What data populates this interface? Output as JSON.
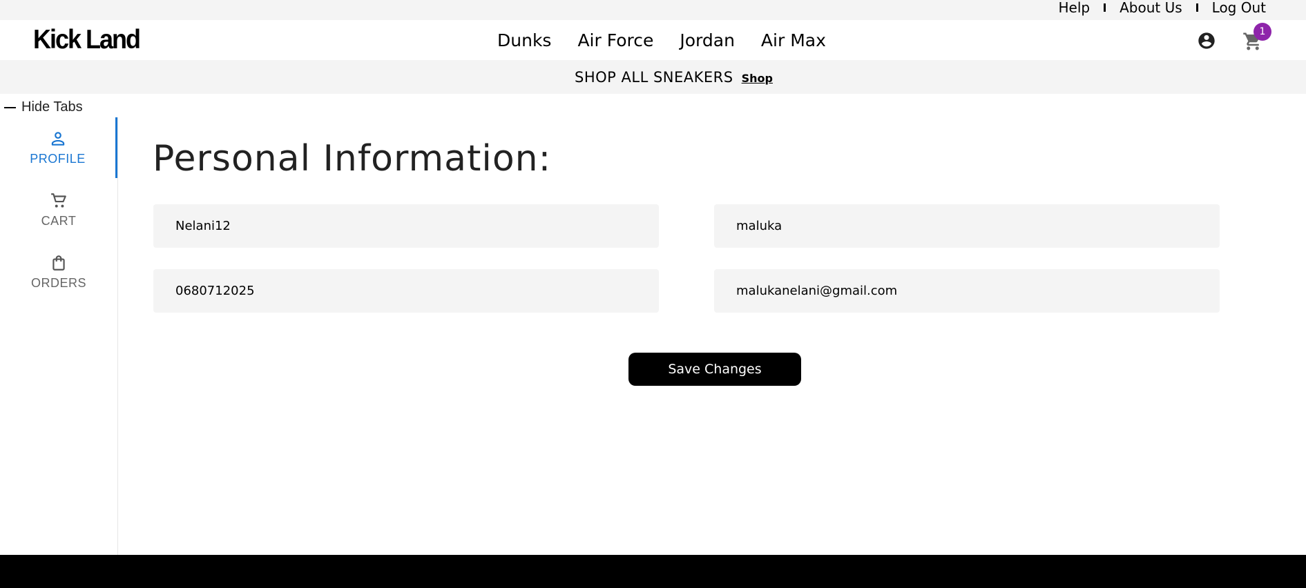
{
  "top_links": {
    "help": "Help",
    "about": "About Us",
    "logout": "Log Out"
  },
  "brand": {
    "logo": "Kick Land"
  },
  "nav": {
    "dunks": "Dunks",
    "air_force": "Air Force",
    "jordan": "Jordan",
    "air_max": "Air Max"
  },
  "cart": {
    "count": "1"
  },
  "promo": {
    "text": "SHOP ALL SNEAKERS",
    "link": "Shop"
  },
  "sidebar": {
    "toggle_label": "Hide Tabs",
    "tabs": [
      {
        "label": "PROFILE",
        "icon": "person-icon",
        "active": true
      },
      {
        "label": "CART",
        "icon": "cart-icon",
        "active": false
      },
      {
        "label": "ORDERS",
        "icon": "shopping-bag-icon",
        "active": false
      }
    ]
  },
  "profile": {
    "title": "Personal Information:",
    "username": "Nelani12",
    "surname": "maluka",
    "phone": "0680712025",
    "email": "malukanelani@gmail.com",
    "save_label": "Save Changes"
  },
  "colors": {
    "accent": "#1976d2",
    "badge": "#8e24aa",
    "field_bg": "#f4f4f4",
    "footer": "#000000"
  }
}
